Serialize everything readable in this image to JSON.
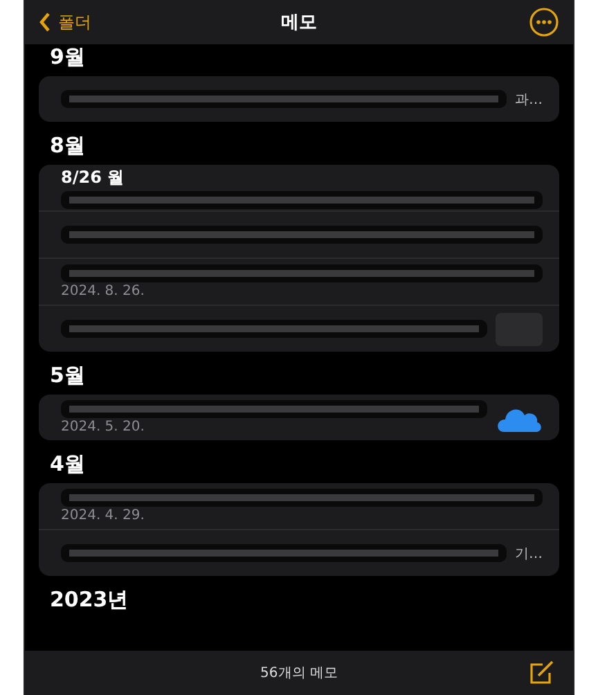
{
  "nav": {
    "back_label": "폴더",
    "title": "메모"
  },
  "sections": [
    {
      "heading": "9월",
      "notes": [
        {
          "kind": "plain",
          "trailing": "과…"
        }
      ]
    },
    {
      "heading": "8월",
      "notes": [
        {
          "kind": "plain",
          "title": "8/26 월"
        },
        {
          "kind": "plain"
        },
        {
          "kind": "plain",
          "date": "2024. 8. 26."
        },
        {
          "kind": "thumbnail"
        }
      ]
    },
    {
      "heading": "5월",
      "notes": [
        {
          "kind": "cloud",
          "date": "2024. 5. 20."
        }
      ]
    },
    {
      "heading": "4월",
      "notes": [
        {
          "kind": "plain",
          "date": "2024. 4. 29."
        },
        {
          "kind": "plain",
          "trailing": "기…"
        }
      ]
    },
    {
      "heading": "2023년"
    }
  ],
  "footer": {
    "count": "56개의 메모"
  }
}
